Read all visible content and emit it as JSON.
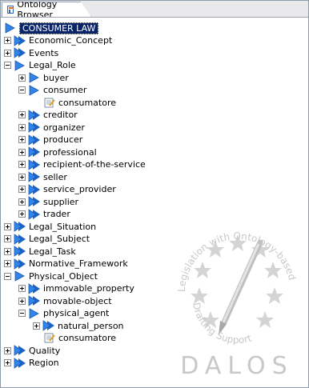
{
  "tab": {
    "title": "Ontology Browser"
  },
  "colors": {
    "node_blue": "#2f86e8",
    "selection": "#0a246a",
    "watermark_gray": "#c8c8c8"
  },
  "tree": [
    {
      "label": "CONSUMER LAW",
      "level": 0,
      "toggle": "none",
      "icon": "node-icon",
      "selected": true
    },
    {
      "label": "Economic_Concept",
      "level": 0,
      "toggle": "plus",
      "icon": "multi-node-icon"
    },
    {
      "label": "Events",
      "level": 0,
      "toggle": "plus",
      "icon": "multi-node-icon"
    },
    {
      "label": "Legal_Role",
      "level": 0,
      "toggle": "minus",
      "icon": "node-icon"
    },
    {
      "label": "buyer",
      "level": 1,
      "toggle": "plus",
      "icon": "node-icon"
    },
    {
      "label": "consumer",
      "level": 1,
      "toggle": "minus",
      "icon": "node-icon"
    },
    {
      "label": "consumatore",
      "level": 2,
      "toggle": "none",
      "icon": "document-icon"
    },
    {
      "label": "creditor",
      "level": 1,
      "toggle": "plus",
      "icon": "multi-node-icon"
    },
    {
      "label": "organizer",
      "level": 1,
      "toggle": "plus",
      "icon": "multi-node-icon"
    },
    {
      "label": "producer",
      "level": 1,
      "toggle": "plus",
      "icon": "multi-node-icon"
    },
    {
      "label": "professional",
      "level": 1,
      "toggle": "plus",
      "icon": "multi-node-icon"
    },
    {
      "label": "recipient-of-the-service",
      "level": 1,
      "toggle": "plus",
      "icon": "multi-node-icon"
    },
    {
      "label": "seller",
      "level": 1,
      "toggle": "plus",
      "icon": "multi-node-icon"
    },
    {
      "label": "service_provider",
      "level": 1,
      "toggle": "plus",
      "icon": "multi-node-icon"
    },
    {
      "label": "supplier",
      "level": 1,
      "toggle": "plus",
      "icon": "multi-node-icon"
    },
    {
      "label": "trader",
      "level": 1,
      "toggle": "plus",
      "icon": "multi-node-icon"
    },
    {
      "label": "Legal_Situation",
      "level": 0,
      "toggle": "plus",
      "icon": "multi-node-icon"
    },
    {
      "label": "Legal_Subject",
      "level": 0,
      "toggle": "plus",
      "icon": "multi-node-icon"
    },
    {
      "label": "Legal_Task",
      "level": 0,
      "toggle": "plus",
      "icon": "multi-node-icon"
    },
    {
      "label": "Normative_Framework",
      "level": 0,
      "toggle": "plus",
      "icon": "multi-node-icon"
    },
    {
      "label": "Physical_Object",
      "level": 0,
      "toggle": "minus",
      "icon": "node-icon"
    },
    {
      "label": "immovable_property",
      "level": 1,
      "toggle": "plus",
      "icon": "multi-node-icon"
    },
    {
      "label": "movable-object",
      "level": 1,
      "toggle": "plus",
      "icon": "multi-node-icon"
    },
    {
      "label": "physical_agent",
      "level": 1,
      "toggle": "minus",
      "icon": "node-icon"
    },
    {
      "label": "natural_person",
      "level": 2,
      "toggle": "plus",
      "icon": "multi-node-icon"
    },
    {
      "label": "consumatore",
      "level": 2,
      "toggle": "none",
      "icon": "document-icon"
    },
    {
      "label": "Quality",
      "level": 0,
      "toggle": "plus",
      "icon": "multi-node-icon"
    },
    {
      "label": "Region",
      "level": 0,
      "toggle": "plus",
      "icon": "multi-node-icon"
    }
  ],
  "watermark": {
    "arc_text_top": "Legislation with Ontology-based",
    "arc_text_bottom": "Drafting Support",
    "brand": "DALOS"
  }
}
